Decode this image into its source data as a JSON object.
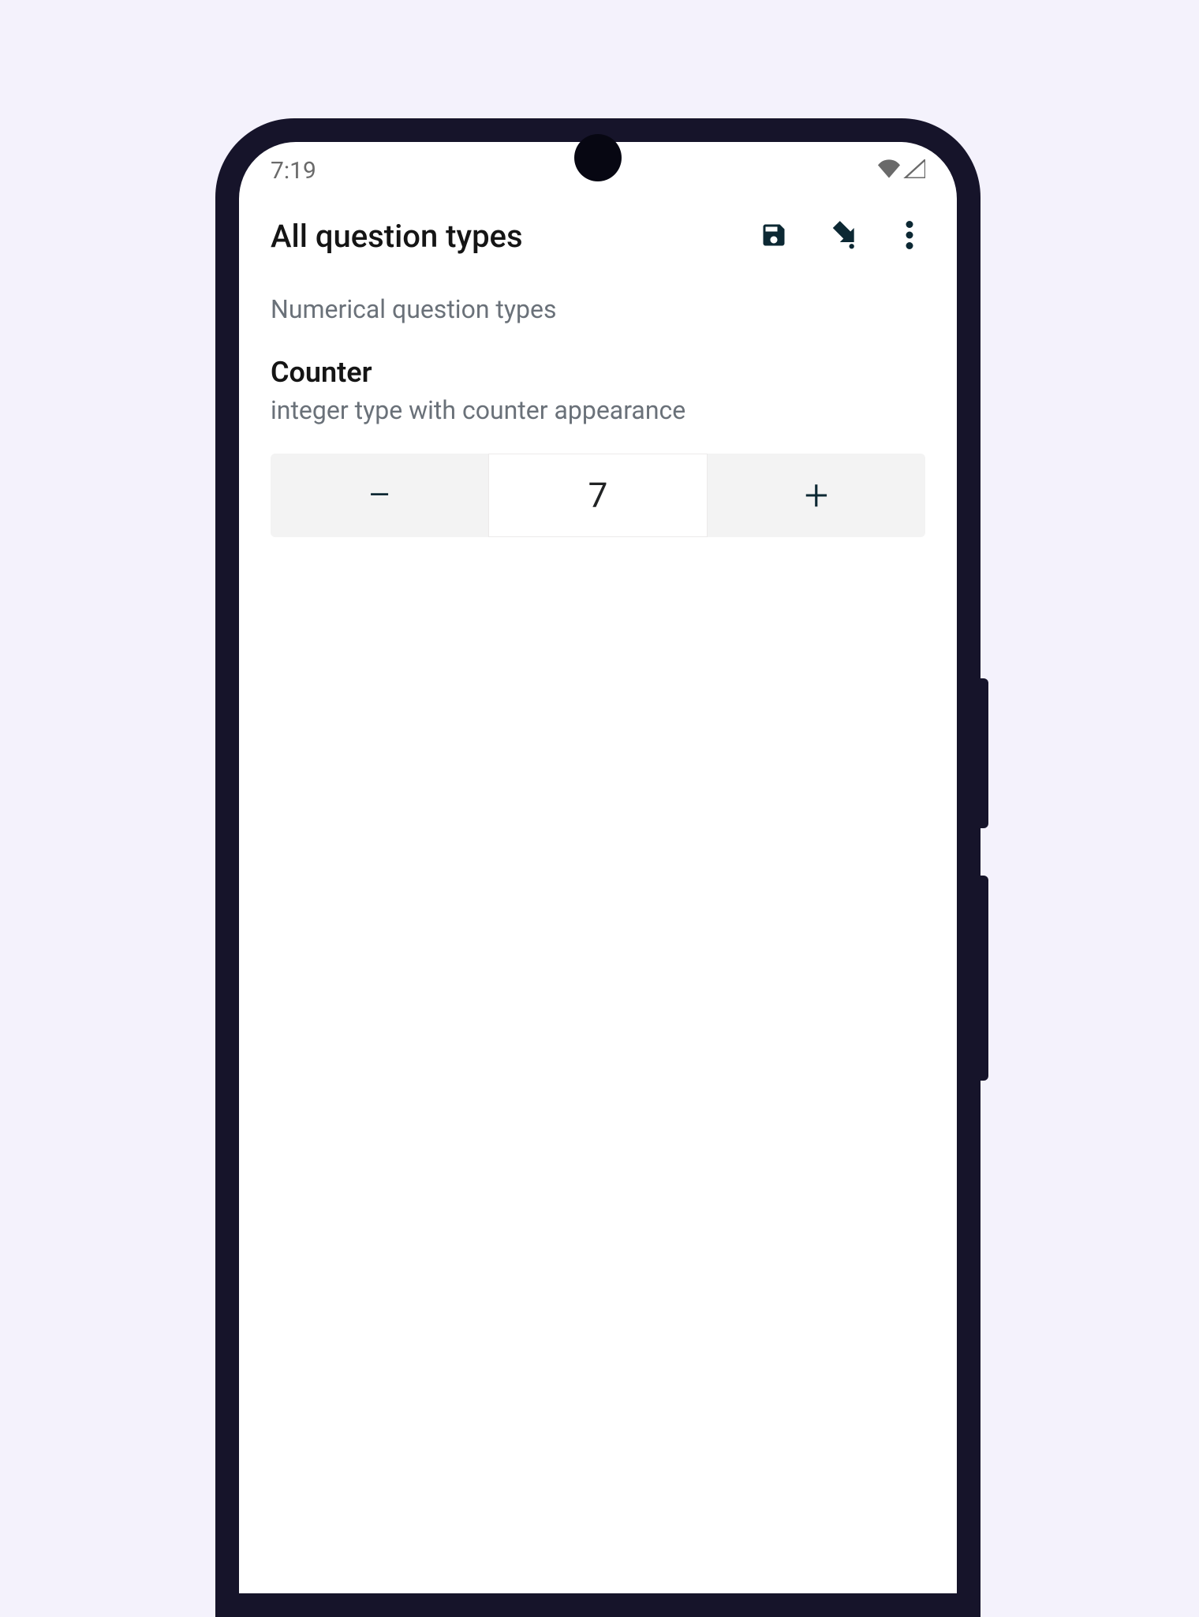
{
  "status": {
    "time": "7:19"
  },
  "header": {
    "title": "All question types"
  },
  "section": {
    "label": "Numerical question types"
  },
  "question": {
    "title": "Counter",
    "subtitle": "integer type with counter appearance"
  },
  "counter": {
    "minus": "−",
    "plus": "+",
    "value": "7"
  }
}
